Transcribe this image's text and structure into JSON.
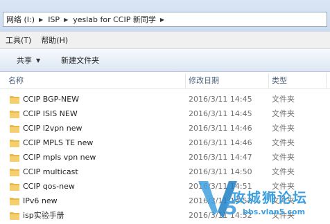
{
  "address": {
    "crumbs": [
      "网络 (I:)",
      "ISP",
      "yeslab for CCIP 新同学"
    ]
  },
  "menu": {
    "items": [
      "工具(T)",
      "帮助(H)"
    ]
  },
  "toolbar": {
    "share_label": "共享",
    "new_folder_label": "新建文件夹"
  },
  "columns": {
    "name": "名称",
    "modified": "修改日期",
    "type": "类型"
  },
  "files": [
    {
      "name": "CCIP BGP-NEW",
      "modified": "2016/3/11 14:45",
      "type": "文件夹"
    },
    {
      "name": "CCIP ISIS NEW",
      "modified": "2016/3/11 14:45",
      "type": "文件夹"
    },
    {
      "name": "CCIP l2vpn new",
      "modified": "2016/3/11 14:46",
      "type": "文件夹"
    },
    {
      "name": "CCIP MPLS TE new",
      "modified": "2016/3/11 14:46",
      "type": "文件夹"
    },
    {
      "name": "CCIP mpls vpn new",
      "modified": "2016/3/11 14:47",
      "type": "文件夹"
    },
    {
      "name": "CCIP multicast",
      "modified": "2016/3/11 14:50",
      "type": "文件夹"
    },
    {
      "name": "CCIP qos-new",
      "modified": "2016/3/11 14:51",
      "type": "文件夹"
    },
    {
      "name": "IPv6 new",
      "modified": "2016/3/11 14:52",
      "type": "文件夹"
    },
    {
      "name": "isp实验手册",
      "modified": "2016/3/11 14:52",
      "type": "文件夹"
    }
  ],
  "watermark": {
    "title": "攻城狮论坛",
    "url": "bbs.vlan5.com"
  },
  "colors": {
    "folder": "#e8b84a",
    "accent": "#3fa0e0"
  }
}
